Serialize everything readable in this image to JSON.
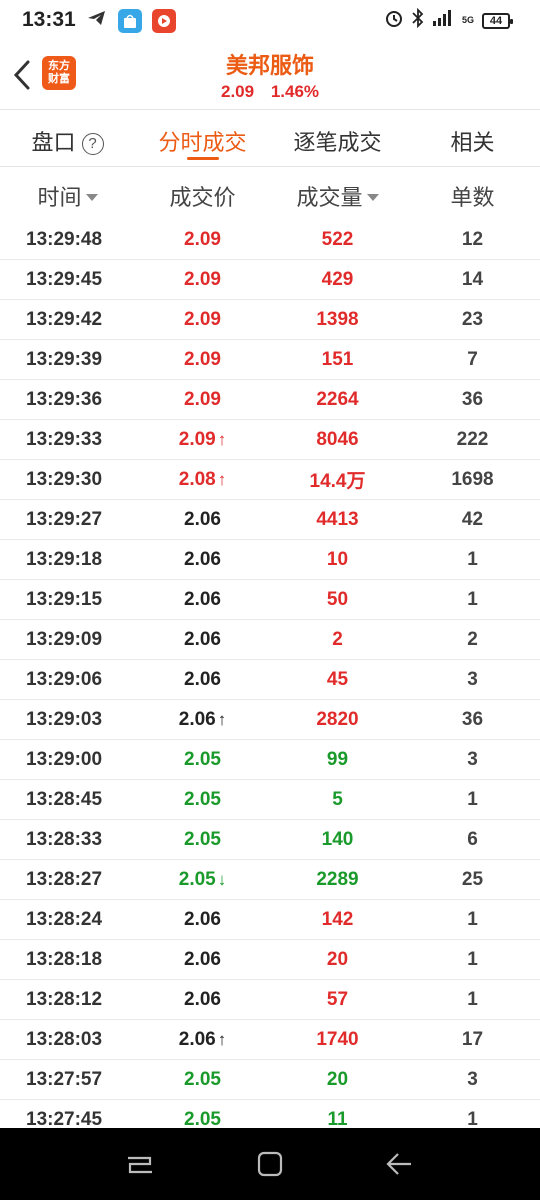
{
  "status_bar": {
    "time": "13:31",
    "network": "5G",
    "battery": "44"
  },
  "header": {
    "stock_name": "美邦服饰",
    "price": "2.09",
    "change_pct": "1.46%",
    "logo_line1": "东方",
    "logo_line2": "财富"
  },
  "tabs": [
    {
      "label": "盘口",
      "active": false
    },
    {
      "label": "分时成交",
      "active": true
    },
    {
      "label": "逐笔成交",
      "active": false
    },
    {
      "label": "相关",
      "active": false
    }
  ],
  "columns": [
    "时间",
    "成交价",
    "成交量",
    "单数"
  ],
  "colors": {
    "up": "#e12b2b",
    "down": "#1a9a2a",
    "flat": "#222222",
    "accent": "#ec5b13"
  },
  "rows": [
    {
      "time": "13:29:48",
      "price": "2.09",
      "pc": "red",
      "arrow": "",
      "volume": "522",
      "vc": "red",
      "count": "12"
    },
    {
      "time": "13:29:45",
      "price": "2.09",
      "pc": "red",
      "arrow": "",
      "volume": "429",
      "vc": "red",
      "count": "14"
    },
    {
      "time": "13:29:42",
      "price": "2.09",
      "pc": "red",
      "arrow": "",
      "volume": "1398",
      "vc": "red",
      "count": "23"
    },
    {
      "time": "13:29:39",
      "price": "2.09",
      "pc": "red",
      "arrow": "",
      "volume": "151",
      "vc": "red",
      "count": "7"
    },
    {
      "time": "13:29:36",
      "price": "2.09",
      "pc": "red",
      "arrow": "",
      "volume": "2264",
      "vc": "red",
      "count": "36"
    },
    {
      "time": "13:29:33",
      "price": "2.09",
      "pc": "red",
      "arrow": "↑",
      "volume": "8046",
      "vc": "red",
      "count": "222"
    },
    {
      "time": "13:29:30",
      "price": "2.08",
      "pc": "red",
      "arrow": "↑",
      "volume": "14.4万",
      "vc": "red",
      "count": "1698"
    },
    {
      "time": "13:29:27",
      "price": "2.06",
      "pc": "black",
      "arrow": "",
      "volume": "4413",
      "vc": "red",
      "count": "42"
    },
    {
      "time": "13:29:18",
      "price": "2.06",
      "pc": "black",
      "arrow": "",
      "volume": "10",
      "vc": "red",
      "count": "1"
    },
    {
      "time": "13:29:15",
      "price": "2.06",
      "pc": "black",
      "arrow": "",
      "volume": "50",
      "vc": "red",
      "count": "1"
    },
    {
      "time": "13:29:09",
      "price": "2.06",
      "pc": "black",
      "arrow": "",
      "volume": "2",
      "vc": "red",
      "count": "2"
    },
    {
      "time": "13:29:06",
      "price": "2.06",
      "pc": "black",
      "arrow": "",
      "volume": "45",
      "vc": "red",
      "count": "3"
    },
    {
      "time": "13:29:03",
      "price": "2.06",
      "pc": "black",
      "arrow": "↑",
      "volume": "2820",
      "vc": "red",
      "count": "36"
    },
    {
      "time": "13:29:00",
      "price": "2.05",
      "pc": "green",
      "arrow": "",
      "volume": "99",
      "vc": "green",
      "count": "3"
    },
    {
      "time": "13:28:45",
      "price": "2.05",
      "pc": "green",
      "arrow": "",
      "volume": "5",
      "vc": "green",
      "count": "1"
    },
    {
      "time": "13:28:33",
      "price": "2.05",
      "pc": "green",
      "arrow": "",
      "volume": "140",
      "vc": "green",
      "count": "6"
    },
    {
      "time": "13:28:27",
      "price": "2.05",
      "pc": "green",
      "arrow": "↓",
      "volume": "2289",
      "vc": "green",
      "count": "25"
    },
    {
      "time": "13:28:24",
      "price": "2.06",
      "pc": "black",
      "arrow": "",
      "volume": "142",
      "vc": "red",
      "count": "1"
    },
    {
      "time": "13:28:18",
      "price": "2.06",
      "pc": "black",
      "arrow": "",
      "volume": "20",
      "vc": "red",
      "count": "1"
    },
    {
      "time": "13:28:12",
      "price": "2.06",
      "pc": "black",
      "arrow": "",
      "volume": "57",
      "vc": "red",
      "count": "1"
    },
    {
      "time": "13:28:03",
      "price": "2.06",
      "pc": "black",
      "arrow": "↑",
      "volume": "1740",
      "vc": "red",
      "count": "17"
    },
    {
      "time": "13:27:57",
      "price": "2.05",
      "pc": "green",
      "arrow": "",
      "volume": "20",
      "vc": "green",
      "count": "3"
    },
    {
      "time": "13:27:45",
      "price": "2.05",
      "pc": "green",
      "arrow": "",
      "volume": "11",
      "vc": "green",
      "count": "1"
    }
  ]
}
